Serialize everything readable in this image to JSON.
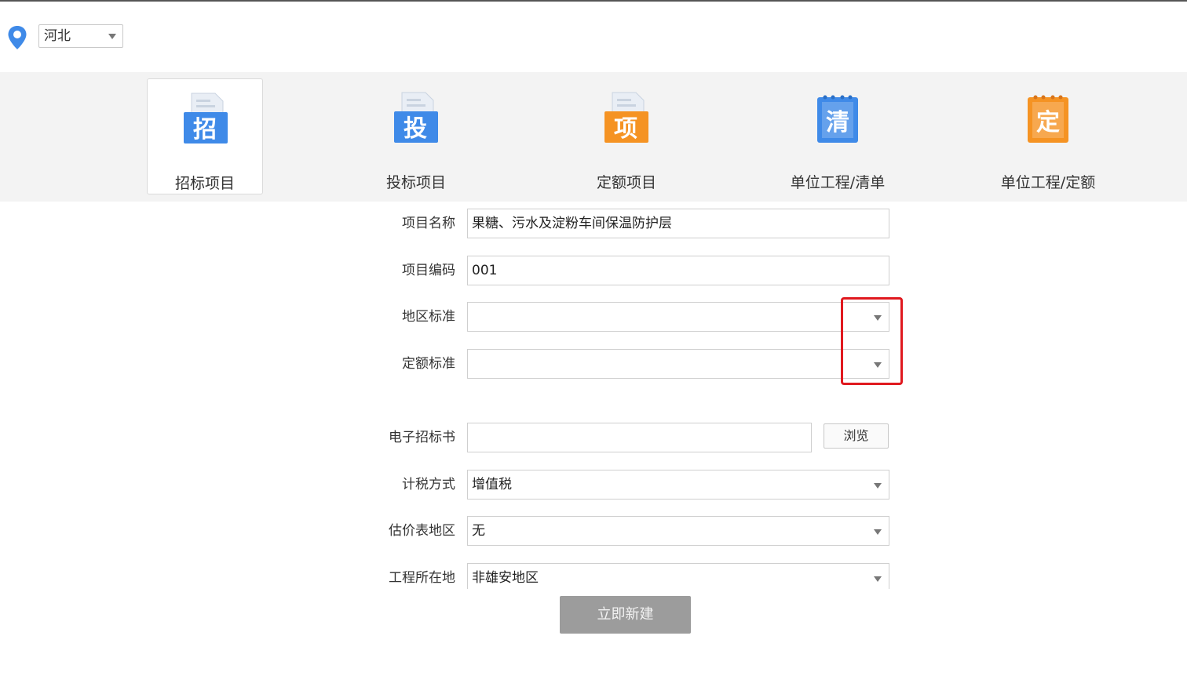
{
  "header": {
    "region": "河北"
  },
  "project_types": [
    {
      "label": "招标项目",
      "icon_char": "招",
      "icon": "bid-document-icon",
      "color": "#3f8ae8",
      "active": true
    },
    {
      "label": "投标项目",
      "icon_char": "投",
      "icon": "tender-document-icon",
      "color": "#3f8ae8",
      "active": false
    },
    {
      "label": "定额项目",
      "icon_char": "项",
      "icon": "quota-project-icon",
      "color": "#f59323",
      "active": false
    },
    {
      "label": "单位工程/清单",
      "icon_char": "清",
      "icon": "unit-list-icon",
      "color": "#3f8ae8",
      "active": false
    },
    {
      "label": "单位工程/定额",
      "icon_char": "定",
      "icon": "unit-quota-icon",
      "color": "#f59323",
      "active": false
    }
  ],
  "form": {
    "project_name": {
      "label": "项目名称",
      "value": "果糖、污水及淀粉车间保温防护层"
    },
    "project_code": {
      "label": "项目编码",
      "value": "001"
    },
    "region_standard": {
      "label": "地区标准",
      "value": ""
    },
    "quota_standard": {
      "label": "定额标准",
      "value": ""
    },
    "e_bid_document": {
      "label": "电子招标书",
      "value": "",
      "browse_label": "浏览"
    },
    "tax_method": {
      "label": "计税方式",
      "value": "增值税"
    },
    "price_table_region": {
      "label": "估价表地区",
      "value": "无"
    },
    "project_location": {
      "label": "工程所在地",
      "value": "非雄安地区"
    }
  },
  "actions": {
    "create_label": "立即新建"
  },
  "colors": {
    "blue_accent": "#3f8ae8",
    "orange_accent": "#f59323",
    "highlight": "#e0191f",
    "create_button": "#9c9c9c"
  }
}
